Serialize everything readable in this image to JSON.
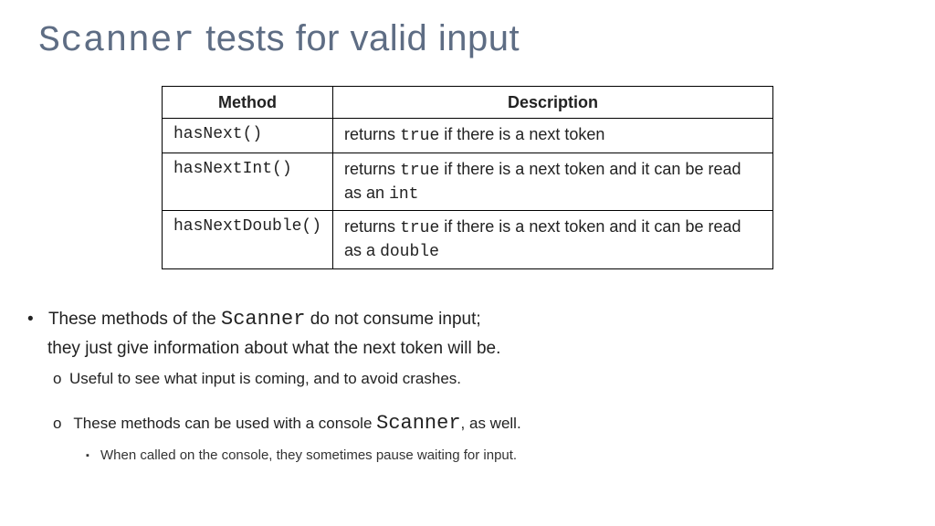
{
  "title": {
    "code": "Scanner",
    "rest": " tests for valid input"
  },
  "table": {
    "headers": {
      "method": "Method",
      "desc": "Description"
    },
    "rows": [
      {
        "method": "hasNext()",
        "desc": {
          "pre": "returns ",
          "code1": "true",
          "post": " if there is a next token"
        }
      },
      {
        "method": "hasNextInt()",
        "desc": {
          "pre": "returns ",
          "code1": "true",
          "mid": " if there is a next token and it can be read as an ",
          "code2": "int"
        }
      },
      {
        "method": "hasNextDouble()",
        "desc": {
          "pre": "returns ",
          "code1": "true",
          "mid": " if there is a next token and it can be read as a ",
          "code2": "double"
        }
      }
    ]
  },
  "bullets": {
    "b1a": "These methods of the ",
    "b1code": "Scanner",
    "b1b": " do not consume input;",
    "b1c": "they just give information about what the next token will be.",
    "b2": "Useful to see what input is coming, and to avoid crashes.",
    "b3a": "These methods can be used with a console ",
    "b3code": "Scanner",
    "b3b": ", as well.",
    "b4": "When called on the console, they sometimes pause waiting for input."
  }
}
